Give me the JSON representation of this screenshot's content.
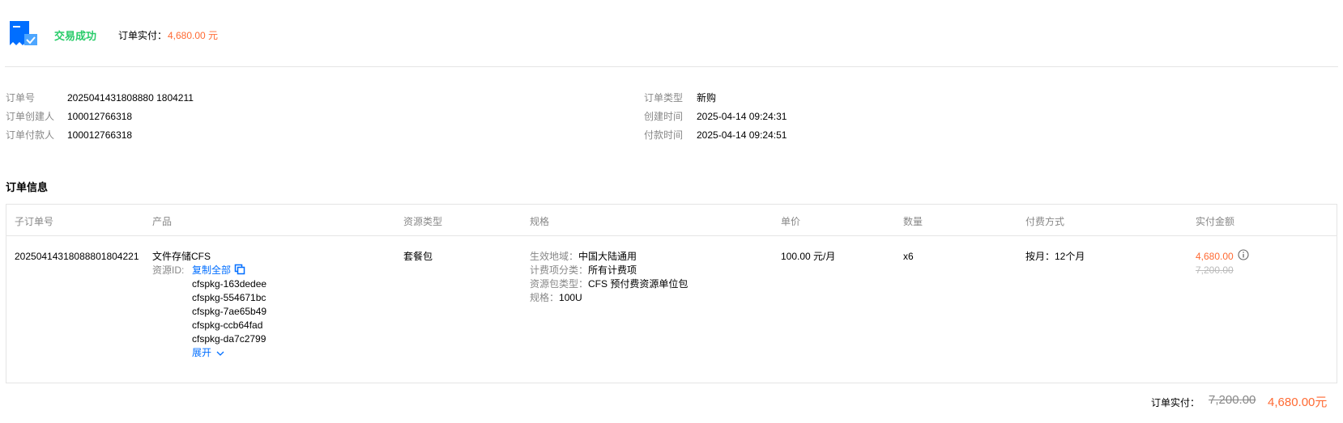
{
  "header": {
    "status": "交易成功",
    "paid_label": "订单实付：",
    "paid_amount": "4,680.00 元"
  },
  "meta_left": [
    {
      "label": "订单号",
      "value": "2025041431808880 1804211"
    },
    {
      "label": "订单创建人",
      "value": "100012766318"
    },
    {
      "label": "订单付款人",
      "value": "100012766318"
    }
  ],
  "meta_right": [
    {
      "label": "订单类型",
      "value": "新购"
    },
    {
      "label": "创建时间",
      "value": "2025-04-14 09:24:31"
    },
    {
      "label": "付款时间",
      "value": "2025-04-14 09:24:51"
    }
  ],
  "section_title": "订单信息",
  "table": {
    "headers": [
      "子订单号",
      "产品",
      "资源类型",
      "规格",
      "单价",
      "数量",
      "付费方式",
      "实付金额"
    ],
    "row": {
      "sub_order_no": "20250414318088801804221",
      "product": "文件存储CFS",
      "resource_id_label": "资源ID:",
      "copy_all": "复制全部",
      "resource_ids": [
        "cfspkg-163dedee",
        "cfspkg-554671bc",
        "cfspkg-7ae65b49",
        "cfspkg-ccb64fad",
        "cfspkg-da7c2799"
      ],
      "expand": "展开",
      "resource_type": "套餐包",
      "specs": [
        {
          "k": "生效地域：",
          "v": "中国大陆通用"
        },
        {
          "k": "计费项分类：",
          "v": "所有计费项"
        },
        {
          "k": "资源包类型：",
          "v": "CFS 预付费资源单位包"
        },
        {
          "k": "规格：",
          "v": "100U"
        }
      ],
      "unit_price": "100.00 元/月",
      "quantity": "x6",
      "billing": "按月：12个月",
      "amount": "4,680.00",
      "original_amount": "7,200.00"
    }
  },
  "footer": {
    "label": "订单实付：",
    "original": "7,200.00",
    "final": "4,680.00元"
  },
  "colors": {
    "success": "#29cc6a",
    "accent": "#ff6a33",
    "link": "#006eff"
  }
}
